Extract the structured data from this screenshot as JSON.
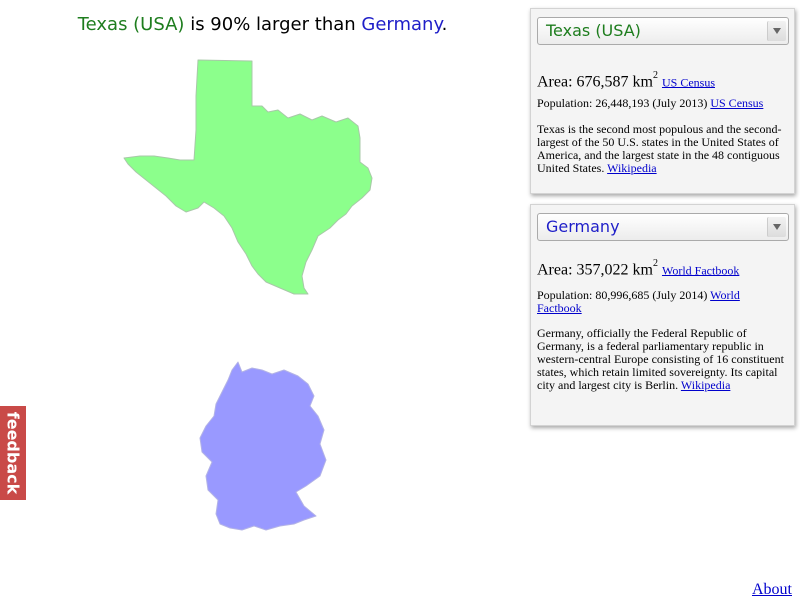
{
  "headline": {
    "country1": "Texas (USA)",
    "middle": " is 90% larger than ",
    "country2": "Germany",
    "end": "."
  },
  "colors": {
    "country1": "#1e7d1e",
    "country2": "#1e1ec8",
    "map1_fill": "#8cff8c",
    "map2_fill": "#9999ff",
    "feedback": "#c94a48"
  },
  "panel1": {
    "selected": "Texas (USA)",
    "area_label": "Area: 676,587 km",
    "area_sup": "2",
    "area_source": "US Census",
    "population": "Population: 26,448,193 (July 2013)",
    "population_source": "US Census",
    "description": "Texas is the second most populous and the second-largest of the 50 U.S. states in the United States of America, and the largest state in the 48 contiguous United States.",
    "description_source": "Wikipedia"
  },
  "panel2": {
    "selected": "Germany",
    "area_label": "Area: 357,022 km",
    "area_sup": "2",
    "area_source": "World Factbook",
    "population": "Population: 80,996,685 (July 2014)",
    "population_source": "World Factbook",
    "description": "Germany, officially the Federal Republic of Germany, is a federal parliamentary republic in western-central Europe consisting of 16 constituent states, which retain limited sovereignty. Its capital city and largest city is Berlin.",
    "description_source": "Wikipedia"
  },
  "feedback_label": "feedback",
  "about_label": "About",
  "icons": {
    "dropdown": "chevron-down-icon",
    "map1": "texas-map-shape",
    "map2": "germany-map-shape"
  }
}
